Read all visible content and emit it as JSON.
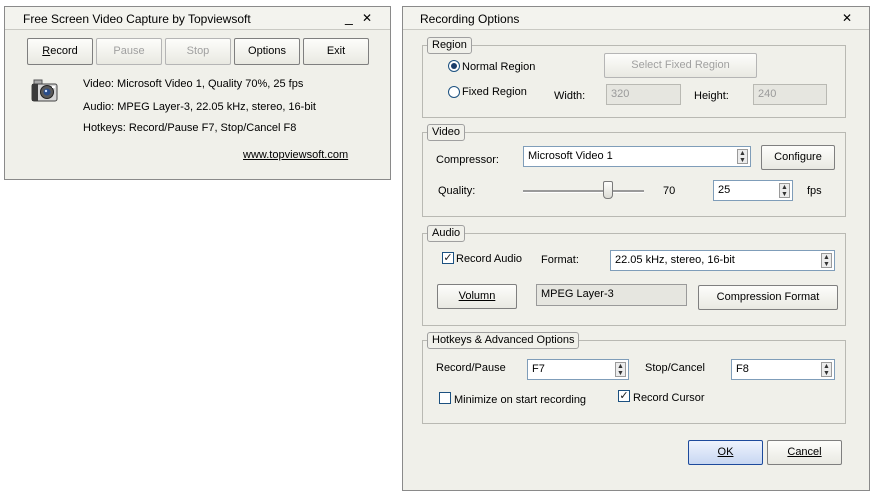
{
  "main_window": {
    "title": "Free Screen Video Capture by Topviewsoft",
    "minimize_glyph": "_",
    "close_glyph": "✕",
    "buttons": {
      "record": "Record",
      "pause": "Pause",
      "stop": "Stop",
      "options": "Options",
      "exit": "Exit"
    },
    "info": {
      "video": "Video: Microsoft Video 1, Quality 70%, 25 fps",
      "audio": "Audio: MPEG Layer-3, 22.05 kHz, stereo, 16-bit",
      "hotkeys": "Hotkeys: Record/Pause F7, Stop/Cancel F8"
    },
    "website": "www.topviewsoft.com",
    "icon": "camera-icon"
  },
  "options_dialog": {
    "title": "Recording Options",
    "close_glyph": "✕",
    "region": {
      "label": "Region",
      "normal_region": "Normal Region",
      "fixed_region": "Fixed Region",
      "selected": "normal",
      "select_fixed_button": "Select Fixed Region",
      "width_label": "Width:",
      "width_value": "320",
      "height_label": "Height:",
      "height_value": "240"
    },
    "video": {
      "label": "Video",
      "compressor_label": "Compressor:",
      "compressor_value": "Microsoft Video 1",
      "configure_button": "Configure",
      "quality_label": "Quality:",
      "quality_value": "70",
      "quality_fraction": 0.7,
      "fps_value": "25",
      "fps_label": "fps"
    },
    "audio": {
      "label": "Audio",
      "record_audio_label": "Record Audio",
      "record_audio_checked": true,
      "format_label": "Format:",
      "format_value": "22.05 kHz, stereo, 16-bit",
      "volumn_button": "Volumn",
      "codec_value": "MPEG Layer-3",
      "compression_format_button": "Compression Format"
    },
    "hotkeys": {
      "label": "Hotkeys & Advanced Options",
      "record_pause_label": "Record/Pause",
      "record_pause_value": "F7",
      "stop_cancel_label": "Stop/Cancel",
      "stop_cancel_value": "F8",
      "minimize_label": "Minimize on start recording",
      "minimize_checked": false,
      "record_cursor_label": "Record Cursor",
      "record_cursor_checked": true
    },
    "ok_button": "OK",
    "cancel_button": "Cancel"
  },
  "colors": {
    "window_bg": "#f0f0ea",
    "default_button": "#1d4a9c",
    "field_border": "#7f9db9"
  }
}
